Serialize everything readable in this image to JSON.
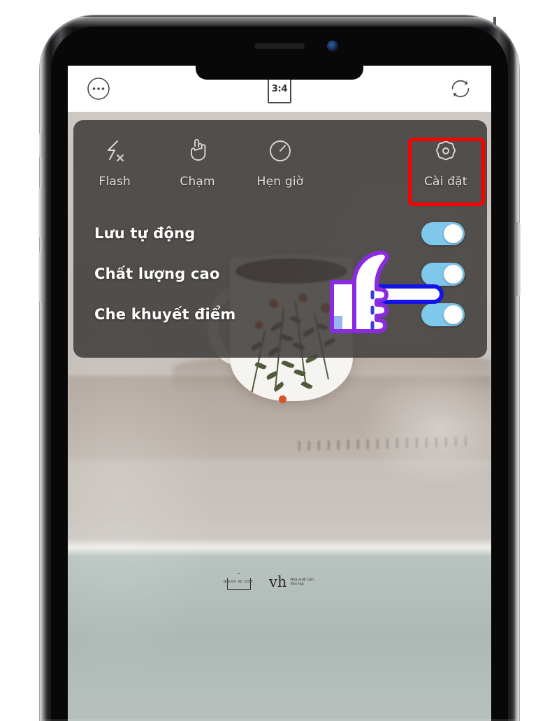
{
  "device": {
    "type": "smartphone",
    "hardware": {
      "earpiece": "earpiece-speaker",
      "front_camera": "front-camera-lens",
      "left_buttons": [
        "mute-switch",
        "volume-up",
        "volume-down"
      ],
      "right_buttons": [
        "power-button"
      ]
    }
  },
  "app": {
    "name": "camera",
    "topbar": {
      "more_icon": "more-options-icon",
      "aspect_ratio": "3:4",
      "flip_icon": "flip-camera-icon"
    },
    "settings_panel": {
      "modes": [
        {
          "label": "Flash",
          "icon": "flash-off-icon"
        },
        {
          "label": "Chạm",
          "icon": "touch-hand-icon"
        },
        {
          "label": "Hẹn giờ",
          "icon": "timer-icon"
        },
        {
          "label": "",
          "icon": "hidden-mode-icon"
        },
        {
          "label": "Cài đặt",
          "icon": "gear-icon"
        }
      ],
      "toggles": [
        {
          "label": "Lưu tự động",
          "state": "on"
        },
        {
          "label": "Chất lượng cao",
          "state": "on"
        },
        {
          "label": "Che khuyết điểm",
          "state": "on"
        }
      ]
    },
    "annotations": {
      "highlight_box": {
        "target": "Cài đặt",
        "color": "#fb0000"
      },
      "pointer": {
        "type": "pointing-hand-cursor",
        "outline_primary": "#8a2be2",
        "outline_secondary": "#1414e6"
      }
    }
  },
  "viewfinder": {
    "subject": "book cover with illustrated coffee mug",
    "publisher_logo_text": "vh",
    "publisher_subtext_line1": "Nhà xuất bản",
    "publisher_subtext_line2": "Văn học",
    "house_logo_text": "NGUOI KE VIET"
  },
  "colors": {
    "toggle_track": "#7ec8ec",
    "toggle_knob": "#ffffff",
    "panel_bg": "rgba(62,58,56,.86)",
    "highlight_red": "#fb0000",
    "topbar_bg": "#ffffff"
  }
}
